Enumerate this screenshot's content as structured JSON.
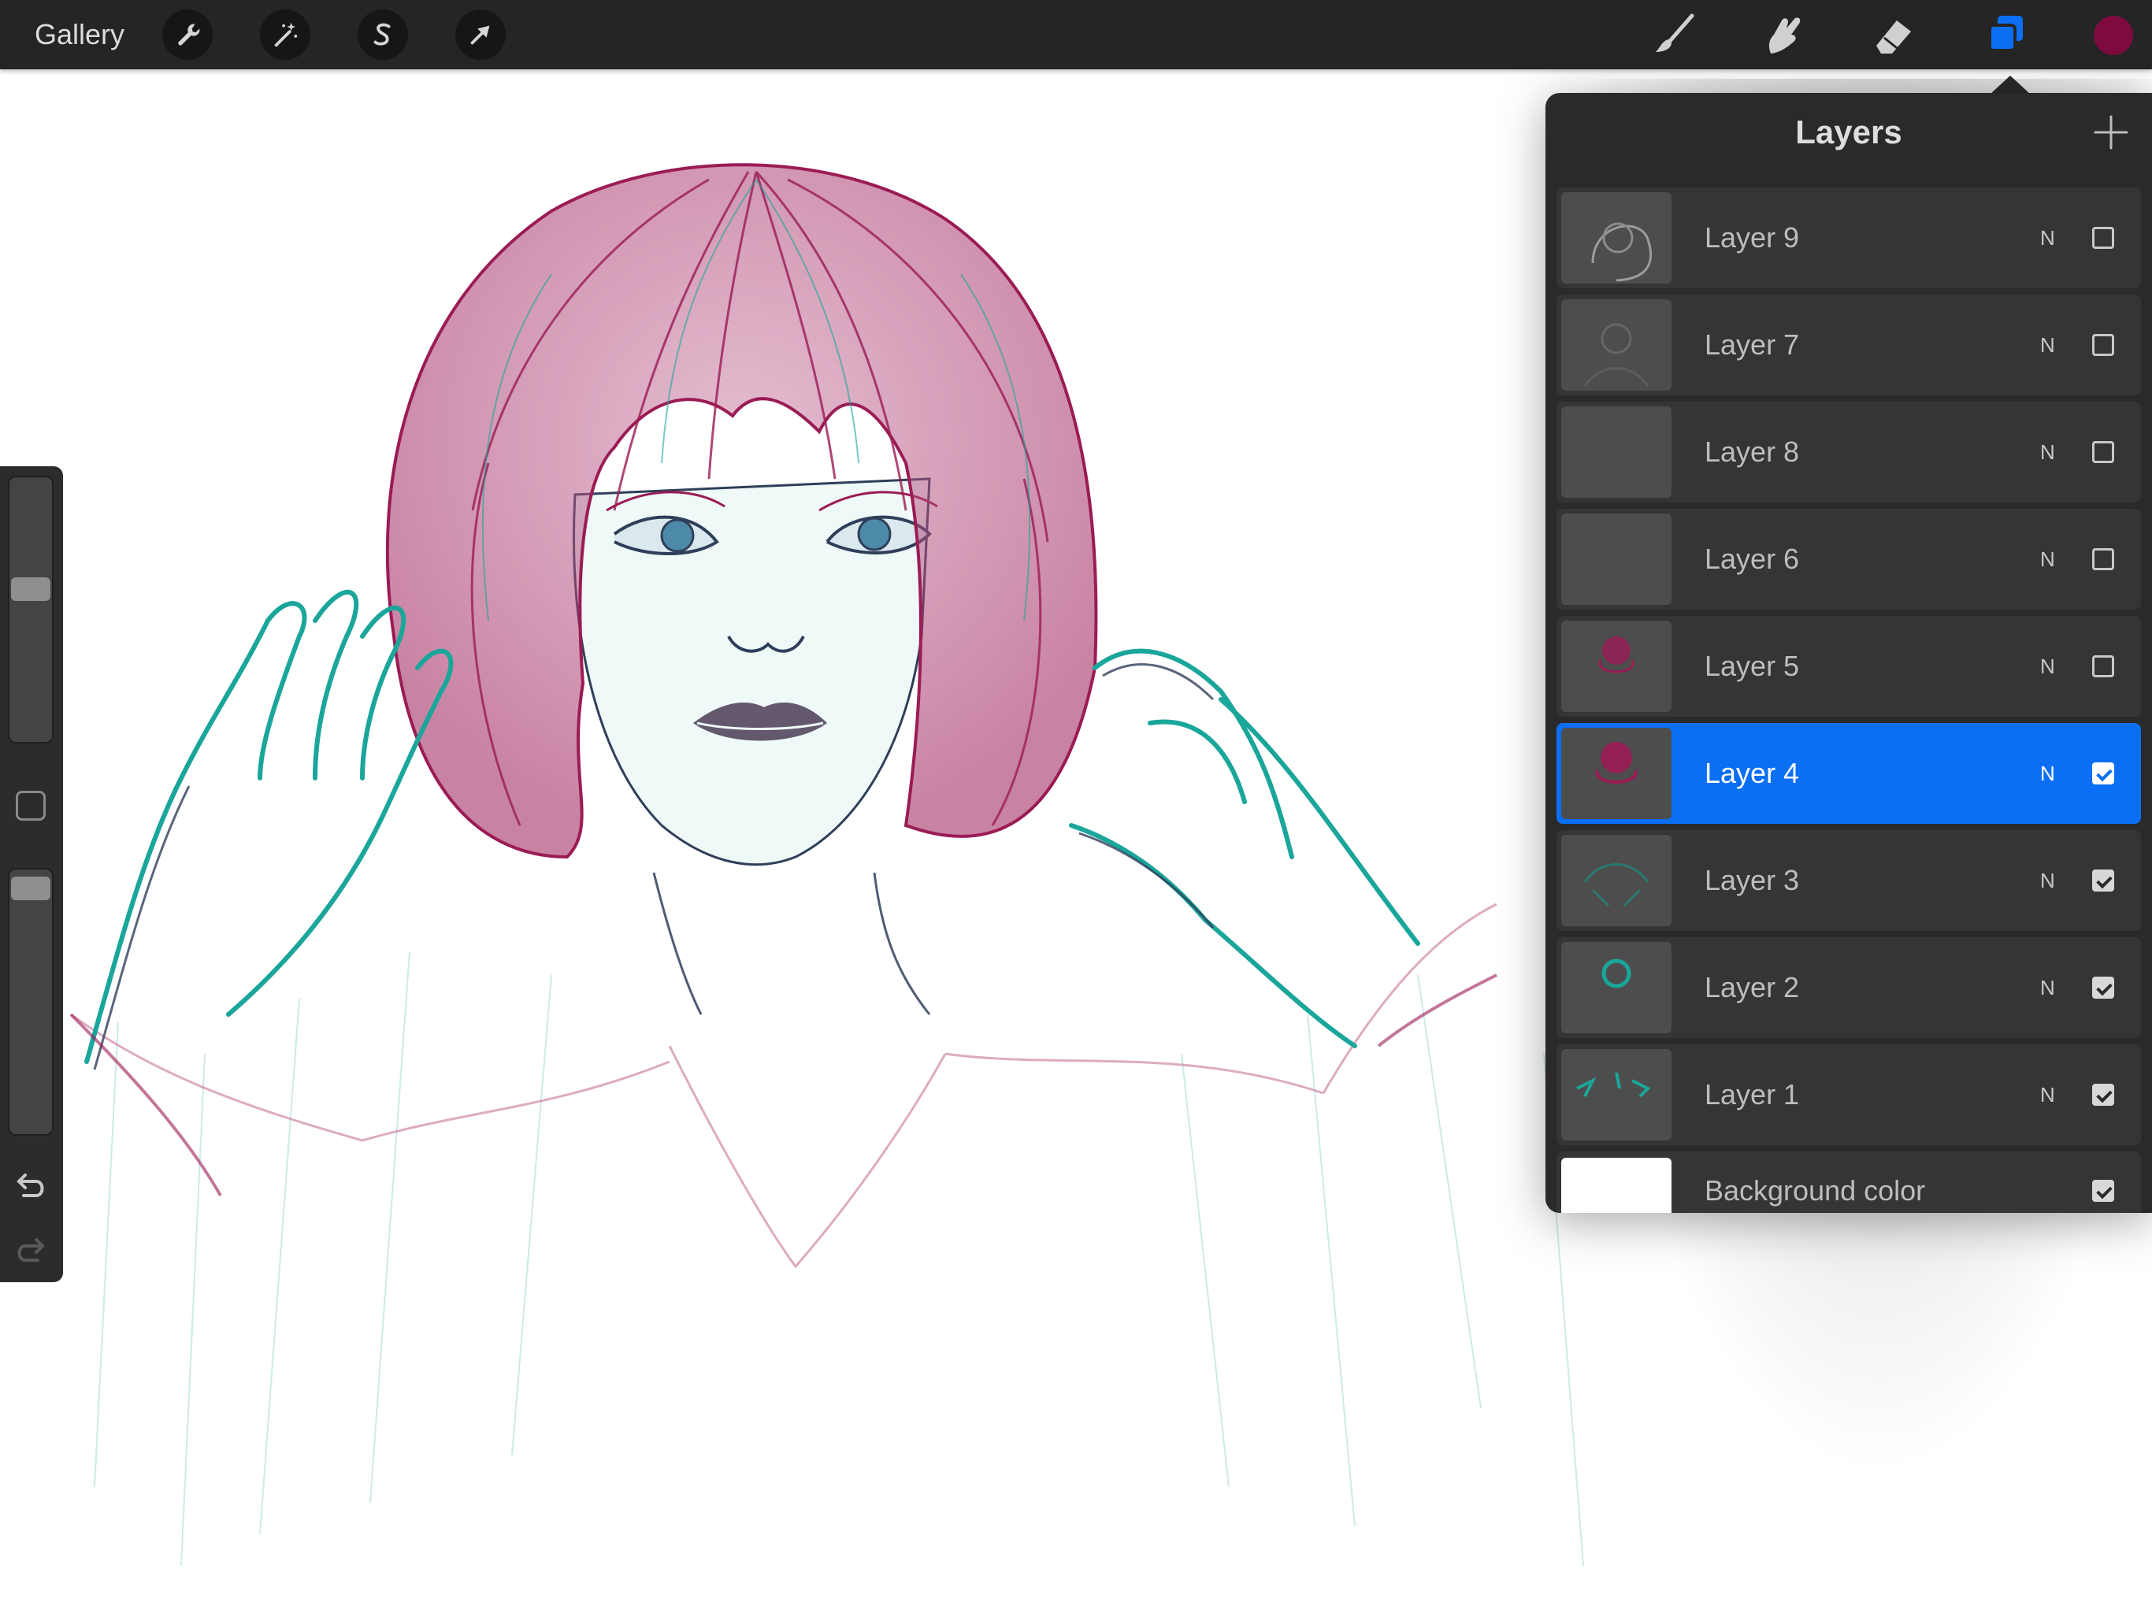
{
  "toolbar": {
    "gallery_label": "Gallery",
    "left_tools": [
      "wrench-icon",
      "magic-wand-icon",
      "selection-s-icon",
      "transform-arrow-icon"
    ],
    "right_tools": [
      "brush-icon",
      "smudge-icon",
      "eraser-icon",
      "layers-icon"
    ],
    "active_color": "#7e0b3e",
    "layers_accent": "#0a6ff4"
  },
  "sidebar": {
    "brush_size_level": 0.58,
    "opacity_level": 0.97,
    "controls": [
      "modify-square",
      "undo-icon",
      "redo-icon"
    ]
  },
  "layers_panel": {
    "title": "Layers",
    "layers": [
      {
        "name": "Layer 9",
        "blend": "N",
        "visible": false,
        "selected": false
      },
      {
        "name": "Layer 7",
        "blend": "N",
        "visible": false,
        "selected": false
      },
      {
        "name": "Layer 8",
        "blend": "N",
        "visible": false,
        "selected": false
      },
      {
        "name": "Layer 6",
        "blend": "N",
        "visible": false,
        "selected": false
      },
      {
        "name": "Layer 5",
        "blend": "N",
        "visible": false,
        "selected": false
      },
      {
        "name": "Layer 4",
        "blend": "N",
        "visible": true,
        "selected": true
      },
      {
        "name": "Layer 3",
        "blend": "N",
        "visible": true,
        "selected": false
      },
      {
        "name": "Layer 2",
        "blend": "N",
        "visible": true,
        "selected": false
      },
      {
        "name": "Layer 1",
        "blend": "N",
        "visible": true,
        "selected": false
      }
    ],
    "background": {
      "name": "Background color",
      "visible": true,
      "color": "#ffffff"
    }
  },
  "canvas": {
    "stroke_colors": [
      "#9b1b55",
      "#1aa69a",
      "#2f3f5a"
    ]
  }
}
